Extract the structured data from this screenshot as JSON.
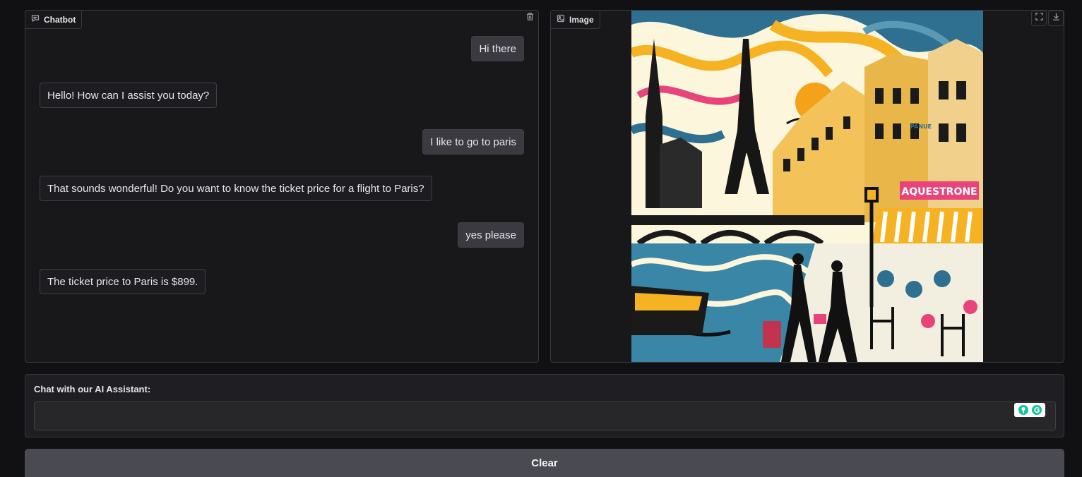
{
  "chatbot": {
    "label": "Chatbot",
    "label_icon": "chat-icon",
    "clear_icon": "trash-icon",
    "messages": [
      {
        "role": "user",
        "text": "Hi there"
      },
      {
        "role": "bot",
        "text": "Hello! How can I assist you today?"
      },
      {
        "role": "user",
        "text": "I like to go to paris"
      },
      {
        "role": "bot",
        "text": "That sounds wonderful! Do you want to know the ticket price for a flight to Paris?"
      },
      {
        "role": "user",
        "text": "yes please"
      },
      {
        "role": "bot",
        "text": "The ticket price to Paris is $899."
      }
    ]
  },
  "image_panel": {
    "label": "Image",
    "label_icon": "image-icon",
    "fullscreen_icon": "fullscreen-icon",
    "download_icon": "download-icon",
    "image_description_sign": "AQUESTRONE",
    "image_sign_small": "PANUE"
  },
  "input": {
    "label": "Chat with our AI Assistant:",
    "value": "",
    "placeholder": "",
    "extension_icon": "grammarly-icon"
  },
  "clear_button": {
    "label": "Clear"
  },
  "colors": {
    "background": "#111113",
    "panel": "#18181b",
    "user_bubble": "#3a3a40",
    "bot_bubble": "#1d1d21",
    "button": "#4a4a52"
  }
}
